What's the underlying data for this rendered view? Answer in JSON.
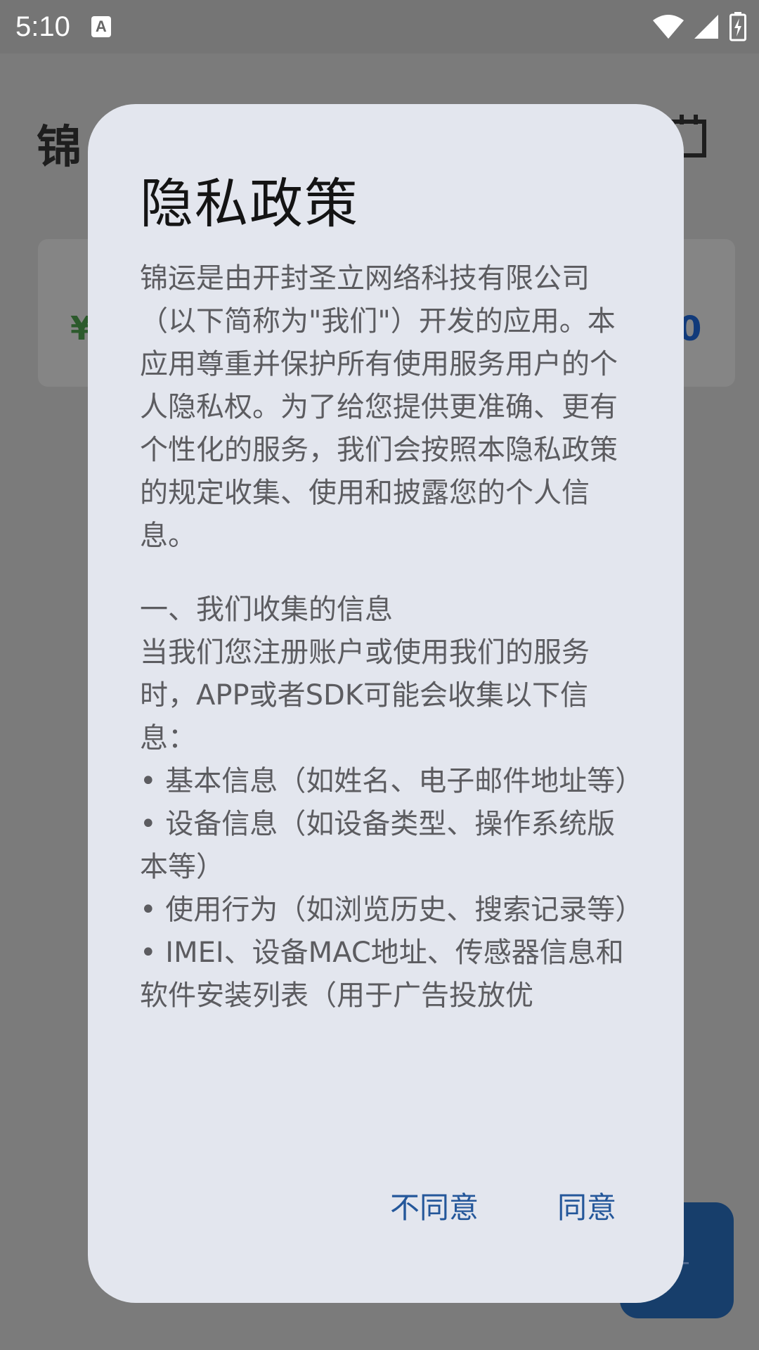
{
  "status_bar": {
    "time": "5:10",
    "notification_glyph": "A",
    "icons": [
      "wifi-icon",
      "signal-icon",
      "battery-charging-icon"
    ]
  },
  "background_app": {
    "title_visible": "锦",
    "card_currency": "¥",
    "card_value_fragment": "0",
    "icons": [
      "calendar-icon"
    ]
  },
  "dialog": {
    "title": "隐私政策",
    "paragraphs": [
      "锦运是由开封圣立网络科技有限公司（以下简称为\"我们\"）开发的应用。本应用尊重并保护所有使用服务用户的个人隐私权。为了给您提供更准确、更有个性化的服务，我们会按照本隐私政策的规定收集、使用和披露您的个人信息。",
      "一、我们收集的信息",
      "当我们您注册账户或使用我们的服务时，APP或者SDK可能会收集以下信息：",
      "• 基本信息（如姓名、电子邮件地址等）",
      "• 设备信息（如设备类型、操作系统版本等）",
      "• 使用行为（如浏览历史、搜索记录等）",
      "• IMEI、设备MAC地址、传感器信息和软件安装列表（用于广告投放优"
    ],
    "disagree_label": "不同意",
    "agree_label": "同意"
  },
  "colors": {
    "scrim": "#7b7b7b",
    "dialog_bg": "#e3e6ee",
    "button_text": "#24579a",
    "fab": "#173e6b"
  }
}
